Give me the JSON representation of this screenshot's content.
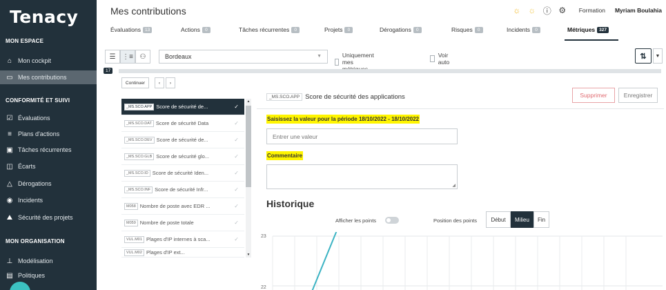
{
  "sidebar": {
    "logo": "Tenacy",
    "sections": {
      "mon_espace": "MON ESPACE",
      "conformite": "CONFORMITÉ ET SUIVI",
      "organisation": "MON ORGANISATION"
    },
    "items": [
      {
        "label": "Mon cockpit",
        "icon": "home-icon"
      },
      {
        "label": "Mes contributions",
        "icon": "chat-icon",
        "active": true
      },
      {
        "label": "Évaluations",
        "icon": "checkbox-icon"
      },
      {
        "label": "Plans d'actions",
        "icon": "list-icon"
      },
      {
        "label": "Tâches récurrentes",
        "icon": "clipboard-icon"
      },
      {
        "label": "Écarts",
        "icon": "gap-icon"
      },
      {
        "label": "Dérogations",
        "icon": "warning-icon"
      },
      {
        "label": "Incidents",
        "icon": "incident-icon"
      },
      {
        "label": "Sécurité des projets",
        "icon": "shield-icon"
      },
      {
        "label": "Modélisation",
        "icon": "hierarchy-icon"
      },
      {
        "label": "Politiques",
        "icon": "book-icon"
      }
    ]
  },
  "header": {
    "title": "Mes contributions",
    "formation": "Formation",
    "user": "Myriam Boulahia"
  },
  "tabs": [
    {
      "label": "Évaluations",
      "count": "13"
    },
    {
      "label": "Actions",
      "count": "0"
    },
    {
      "label": "Tâches récurrentes",
      "count": "0"
    },
    {
      "label": "Projets",
      "count": "0"
    },
    {
      "label": "Dérogations",
      "count": "0"
    },
    {
      "label": "Risques",
      "count": "0"
    },
    {
      "label": "Incidents",
      "count": "0"
    },
    {
      "label": "Métriques",
      "count": "327",
      "active": true
    }
  ],
  "filters": {
    "select_value": "Bordeaux",
    "only_mine": "Uniquement mes métriques",
    "voir_auto": "Voir auto",
    "count": "17"
  },
  "list": {
    "continuer": "Continuer",
    "prev": "‹",
    "next": "›",
    "items": [
      {
        "code": "_MS.SCO.APP",
        "label": "Score de sécurité de...",
        "active": true
      },
      {
        "code": "_MS.SCO.DAT",
        "label": "Score de sécurité Data"
      },
      {
        "code": "_MS.SCO.DEV",
        "label": "Score de sécurité de..."
      },
      {
        "code": "_MS.SCO.GLB",
        "label": "Score de sécurité glo..."
      },
      {
        "code": "_MS.SCO.ID",
        "label": "Score de sécurité Iden..."
      },
      {
        "code": "_MS.SCO.INF",
        "label": "Score de sécurité Infr..."
      },
      {
        "code": "M058",
        "label": "Nombre de poste avec EDR ..."
      },
      {
        "code": "M059",
        "label": "Nombre de poste totale"
      },
      {
        "code": "VUL.M01",
        "label": "Plages d'IP internes à sca..."
      },
      {
        "code": "VUL.M02",
        "label": "Plages d'IP ext..."
      }
    ]
  },
  "detail": {
    "code": "_MS.SCO.APP",
    "title": "Score de sécurité des applications",
    "delete": "Supprimer",
    "save": "Enregistrer",
    "period_label": "Saisissez la valeur pour la période 18/10/2022 - 18/10/2022",
    "value_placeholder": "Entrer une valeur",
    "comment_label": "Commentaire",
    "history_title": "Historique",
    "show_points": "Afficher les points",
    "points_position": "Position des points",
    "positions": [
      "Début",
      "Milieu",
      "Fin"
    ],
    "position_selected": "Milieu"
  },
  "chart_data": {
    "type": "line",
    "y_ticks": [
      "23",
      "22"
    ],
    "series": [
      {
        "values": [
          22,
          23
        ]
      }
    ],
    "grid": true
  },
  "colors": {
    "sidebar_bg": "#22313b",
    "accent": "#22313b",
    "highlight": "#fff500",
    "line": "#3bb3c3",
    "danger": "#e06a70"
  }
}
